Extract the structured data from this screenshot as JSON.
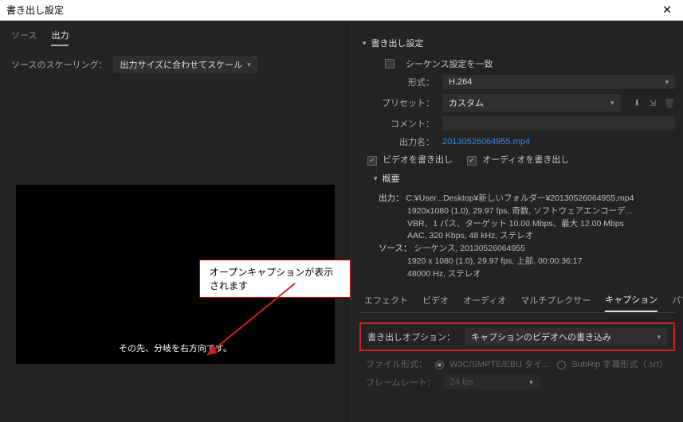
{
  "window": {
    "title": "書き出し設定"
  },
  "left": {
    "tabs": {
      "source": "ソース",
      "output": "出力"
    },
    "scaling_label": "ソースのスケーリング：",
    "scaling_value": "出力サイズに合わせてスケール",
    "caption_text": "その先、分岐を右方向です。",
    "tooltip": "オープンキャプションが表示されます"
  },
  "right": {
    "section_title": "書き出し設定",
    "match_sequence": "シーケンス設定を一致",
    "format_label": "形式：",
    "format_value": "H.264",
    "preset_label": "プリセット：",
    "preset_value": "カスタム",
    "comments_label": "コメント：",
    "output_label": "出力名：",
    "output_file": "20130526064955.mp4",
    "export_video": "ビデオを書き出し",
    "export_audio": "オーディオを書き出し",
    "summary_title": "概要",
    "summary": {
      "out_label": "出力：",
      "out_path": "C:¥User...Desktop¥新しいフォルダー¥20130526064955.mp4",
      "out_line2": "1920x1080 (1.0), 29.97 fps, 奇数, ソフトウェアエンコーデ...",
      "out_line3": "VBR、1 パス、ターゲット 10.00 Mbps、最大 12.00 Mbps",
      "out_line4": "AAC, 320 Kbps, 48 kHz, ステレオ",
      "src_label": "ソース：",
      "src_line1": "シーケンス, 20130526064955",
      "src_line2": "1920 x 1080 (1.0), 29.97 fps, 上部, 00:00:36:17",
      "src_line3": "48000 Hz, ステレオ"
    },
    "subtabs": {
      "effects": "エフェクト",
      "video": "ビデオ",
      "audio": "オーディオ",
      "mux": "マルチプレクサー",
      "caption": "キャプション",
      "pub": "パブ"
    },
    "export_option_label": "書き出しオプション：",
    "export_option_value": "キャプションのビデオへの書き込み",
    "file_format_label": "ファイル形式：",
    "file_format_opt1": "W3C/SMPTE/EBU タイ...",
    "file_format_opt2": "SubRip 字幕形式（.srt）",
    "framerate_label": "フレームレート：",
    "framerate_value": "24 fps"
  }
}
